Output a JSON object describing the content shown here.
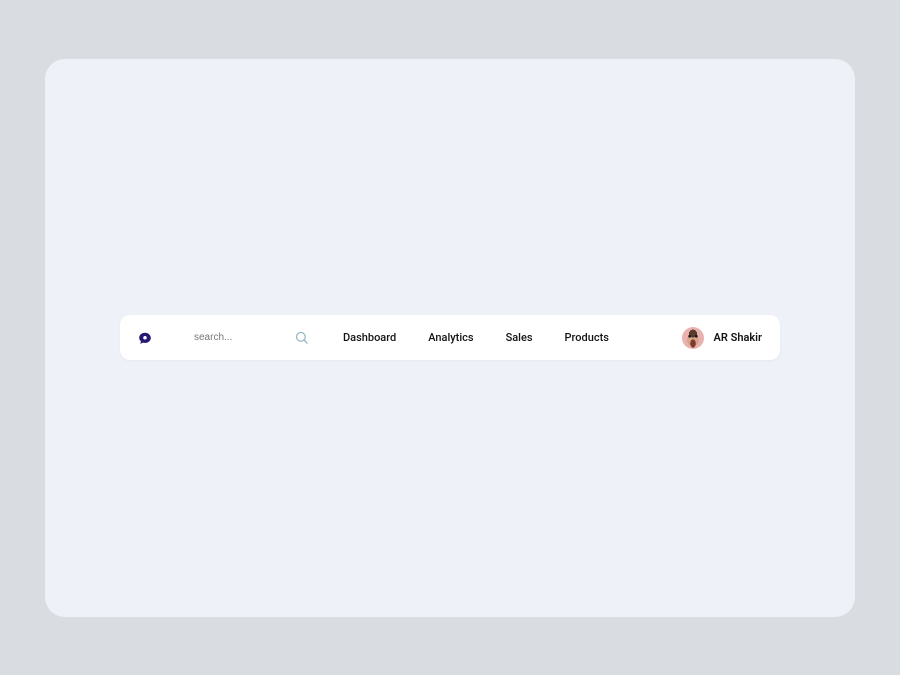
{
  "search": {
    "placeholder": "search..."
  },
  "nav": {
    "items": [
      "Dashboard",
      "Analytics",
      "Sales",
      "Products"
    ]
  },
  "user": {
    "name": "AR Shakir"
  },
  "icons": {
    "logo": "chat-bubble-icon",
    "search": "search-icon"
  },
  "colors": {
    "pageBg": "#d9dce1",
    "panelBg": "#eef1f7",
    "navbarBg": "#ffffff",
    "text": "#141414",
    "logo": "#281874",
    "searchIcon": "#92b8c5"
  }
}
